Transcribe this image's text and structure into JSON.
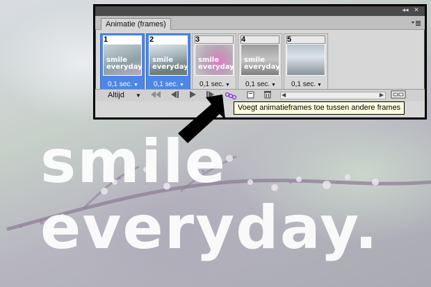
{
  "background": {
    "headline_line1": "smile",
    "headline_line2": "everyday."
  },
  "panel": {
    "tab_label": "Animatie (frames)",
    "collapse_glyph": "◂◂",
    "close_glyph": "✕",
    "menu_icon": "panel-menu-icon",
    "frames": [
      {
        "number": "1",
        "delay": "0,1 sec.",
        "selected": true,
        "thumb_text_1": "smile",
        "thumb_text_2": "everyday."
      },
      {
        "number": "2",
        "delay": "0,1 sec.",
        "selected": true,
        "thumb_text_1": "smile",
        "thumb_text_2": "everyday."
      },
      {
        "number": "3",
        "delay": "0,1 sec.",
        "selected": false,
        "thumb_text_1": "smile",
        "thumb_text_2": "everyday."
      },
      {
        "number": "4",
        "delay": "0,1 sec.",
        "selected": false,
        "thumb_text_1": "smile",
        "thumb_text_2": "everyday."
      },
      {
        "number": "5",
        "delay": "0,1 sec.",
        "selected": false,
        "thumb_text_1": "",
        "thumb_text_2": ""
      }
    ],
    "controls": {
      "loop_value": "Altijd",
      "first_frame_icon": "first-frame-icon",
      "prev_frame_icon": "previous-frame-icon",
      "play_icon": "play-icon",
      "next_frame_icon": "next-frame-icon",
      "tween_icon": "tween-icon",
      "duplicate_icon": "duplicate-frame-icon",
      "delete_icon": "delete-frame-icon",
      "convert_icon": "convert-timeline-icon"
    },
    "tooltip": "Voegt animatieframes toe tussen andere frames"
  },
  "colors": {
    "selection_blue": "#4d86e6",
    "panel_bg": "#d7d7d7",
    "tooltip_bg": "#ffffe1"
  }
}
